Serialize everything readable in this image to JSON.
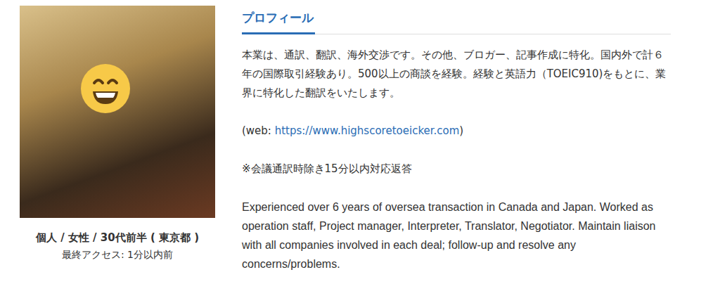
{
  "user": {
    "info": "個人 / 女性 / 30代前半 ( 東京都 )",
    "last_access": "最終アクセス: 1分以内前"
  },
  "profile": {
    "heading": "プロフィール",
    "intro": "本業は、通訳、翻訳、海外交渉です。その他、ブロガー、記事作成に特化。国内外で計６年の国際取引経験あり。500以上の商談を経験。経験と英語力（TOEIC910)をもとに、業界に特化した翻訳をいたします。",
    "web": {
      "prefix": "(web: ",
      "link": "https://www.highscoretoeicker.com",
      "suffix": ")"
    },
    "note": "※会議通訳時除き15分以内対応返答",
    "english": "Experienced over 6 years of oversea transaction in Canada and Japan. Worked as operation staff, Project manager, Interpreter, Translator, Negotiator. Maintain liaison with all companies involved in each deal; follow-up and resolve any concerns/problems."
  }
}
